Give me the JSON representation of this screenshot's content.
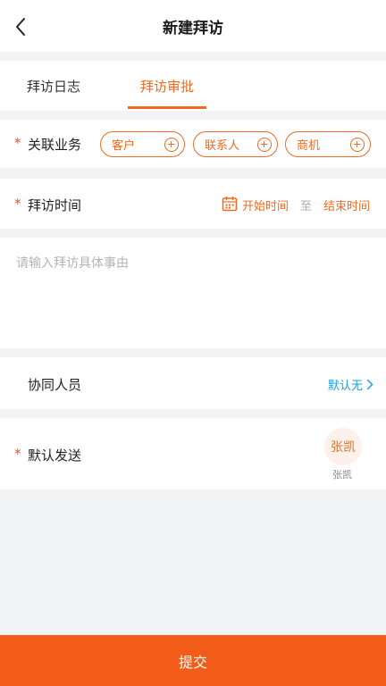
{
  "header": {
    "title": "新建拜访",
    "back_icon": "chevron-left-icon"
  },
  "tabs": [
    {
      "label": "拜访日志",
      "active": false
    },
    {
      "label": "拜访审批",
      "active": true
    }
  ],
  "related_business": {
    "required_mark": "*",
    "label": "关联业务",
    "chips": [
      {
        "label": "客户",
        "icon": "plus-circle-icon"
      },
      {
        "label": "联系人",
        "icon": "plus-circle-icon"
      },
      {
        "label": "商机",
        "icon": "plus-circle-icon"
      }
    ]
  },
  "visit_time": {
    "required_mark": "*",
    "label": "拜访时间",
    "icon": "calendar-icon",
    "start_label": "开始时间",
    "separator": "至",
    "end_label": "结束时间"
  },
  "description": {
    "placeholder": "请输入拜访具体事由",
    "value": ""
  },
  "colleagues": {
    "label": "协同人员",
    "value": "默认无",
    "icon": "chevron-right-icon"
  },
  "default_send": {
    "required_mark": "*",
    "label": "默认发送",
    "avatar_text": "张凯",
    "name": "张凯"
  },
  "submit_label": "提交",
  "colors": {
    "accent": "#f06a23",
    "submit_bg": "#f25c19",
    "link": "#1aa0e6",
    "required": "#e8502b"
  }
}
